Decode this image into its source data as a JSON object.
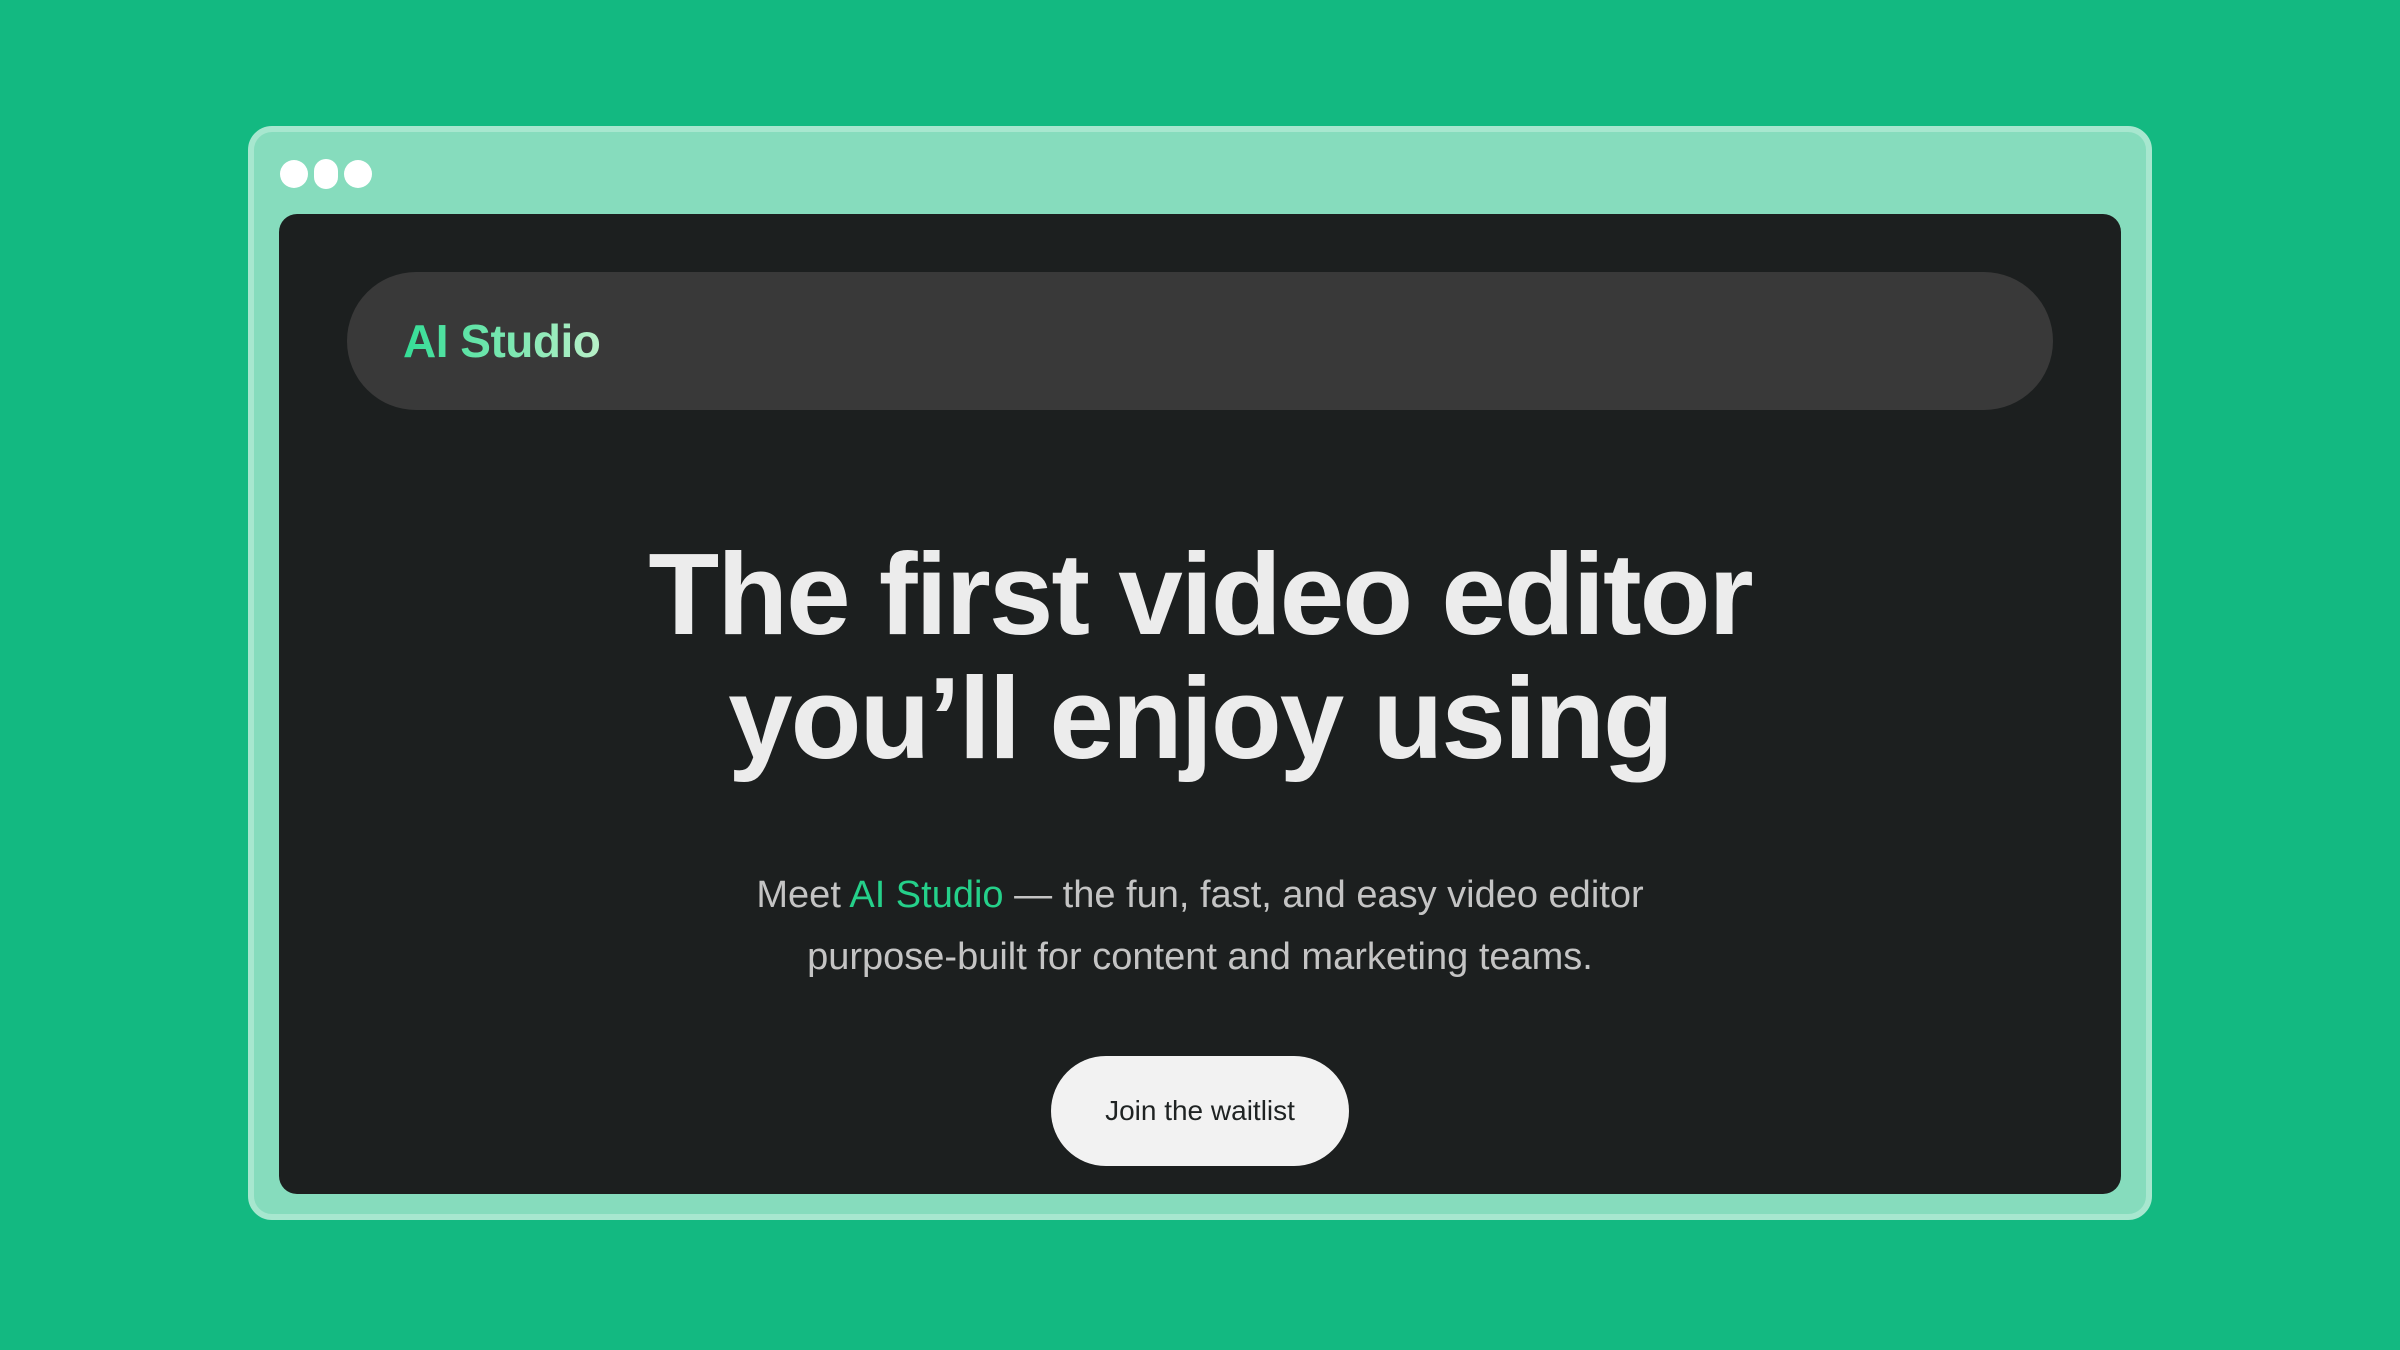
{
  "colors": {
    "background": "#13b981",
    "window_frame": "#86dcbd",
    "viewport": "#1c1f1f",
    "navbar": "#393939",
    "accent": "#25d08a",
    "heading": "#ececec",
    "button": "#f2f2f2"
  },
  "window": {
    "controls": [
      "window-dot",
      "window-dot",
      "window-dot"
    ]
  },
  "navbar": {
    "brand": "AI Studio"
  },
  "hero": {
    "title_line1": "The first video editor",
    "title_line2": "you’ll enjoy using",
    "subtitle": {
      "prefix": "Meet ",
      "highlight": "AI Studio",
      "suffix": " — the fun, fast, and easy video editor",
      "line2": "purpose-built for content and marketing teams."
    },
    "cta_label": "Join the waitlist"
  }
}
